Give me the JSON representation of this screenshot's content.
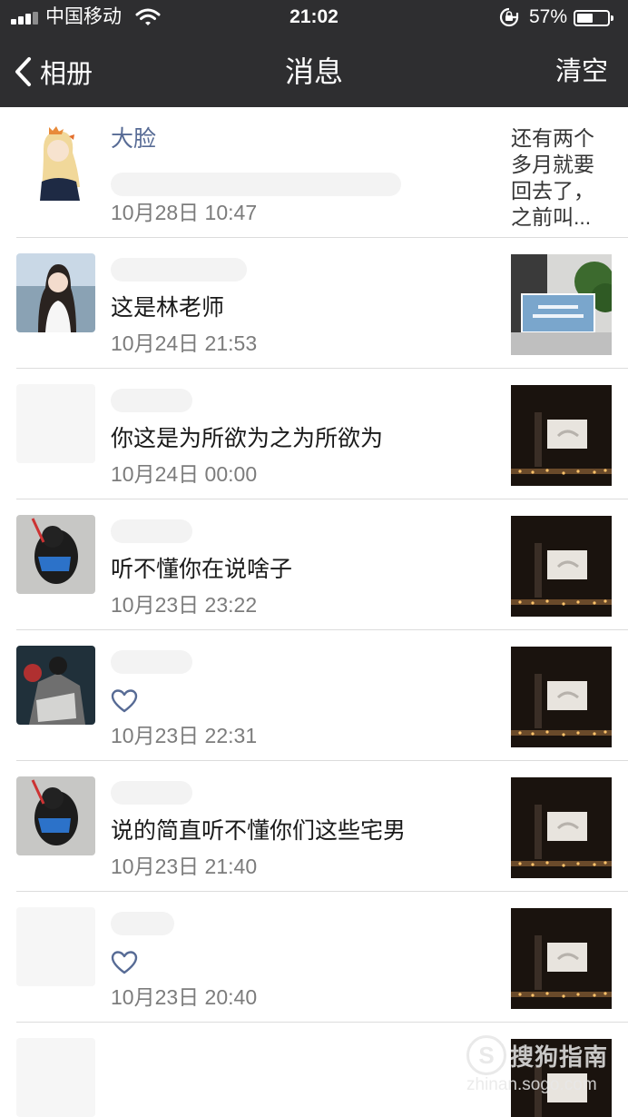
{
  "status_bar": {
    "carrier": "中国移动",
    "time": "21:02",
    "battery_percent_text": "57%",
    "battery_level": 0.57,
    "icons": [
      "signal-icon",
      "wifi-icon",
      "rotation-lock-icon",
      "battery-icon"
    ]
  },
  "nav": {
    "back_label": "相册",
    "title": "消息",
    "clear_label": "清空",
    "background": "#2e2e30"
  },
  "colors": {
    "name_link": "#576b95",
    "timestamp": "#7c7c7c",
    "divider": "#dcdcdc"
  },
  "messages": [
    {
      "name": "大脸",
      "text": "",
      "type": "comment",
      "time": "10月28日 10:47",
      "quote": "还有两个多月就要回去了，之前叫..."
    },
    {
      "name": "",
      "text": "这是林老师",
      "type": "comment",
      "time": "10月24日 21:53"
    },
    {
      "name": "",
      "text": "你这是为所欲为之为所欲为",
      "type": "comment",
      "time": "10月24日 00:00"
    },
    {
      "name": "",
      "text": "听不懂你在说啥子",
      "type": "comment",
      "time": "10月23日 23:22"
    },
    {
      "name": "",
      "text": "",
      "type": "like",
      "time": "10月23日 22:31"
    },
    {
      "name": "",
      "text": "说的简直听不懂你们这些宅男",
      "type": "comment",
      "time": "10月23日 21:40"
    },
    {
      "name": "",
      "text": "",
      "type": "like",
      "time": "10月23日 20:40"
    },
    {
      "name": "",
      "text": "",
      "type": "comment",
      "time": ""
    }
  ],
  "watermark": {
    "logo_letter": "S",
    "brand": "搜狗指南",
    "domain": "zhinan.sogo.com"
  }
}
